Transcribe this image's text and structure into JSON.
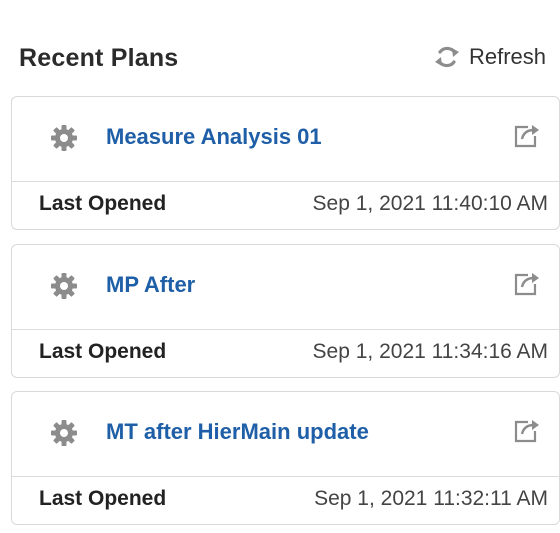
{
  "header": {
    "title": "Recent Plans",
    "refresh_label": "Refresh",
    "refresh_icon": "refresh-icon"
  },
  "plans": [
    {
      "name": "Measure Analysis 01",
      "meta_label": "Last Opened",
      "meta_value": "Sep 1, 2021 11:40:10 AM"
    },
    {
      "name": "MP After",
      "meta_label": "Last Opened",
      "meta_value": "Sep 1, 2021 11:34:16 AM"
    },
    {
      "name": "MT after HierMain update",
      "meta_label": "Last Opened",
      "meta_value": "Sep 1, 2021 11:32:11 AM"
    }
  ],
  "colors": {
    "link": "#1f5fa8",
    "icon_gray": "#8c8c8c",
    "border": "#d9d9d9"
  }
}
